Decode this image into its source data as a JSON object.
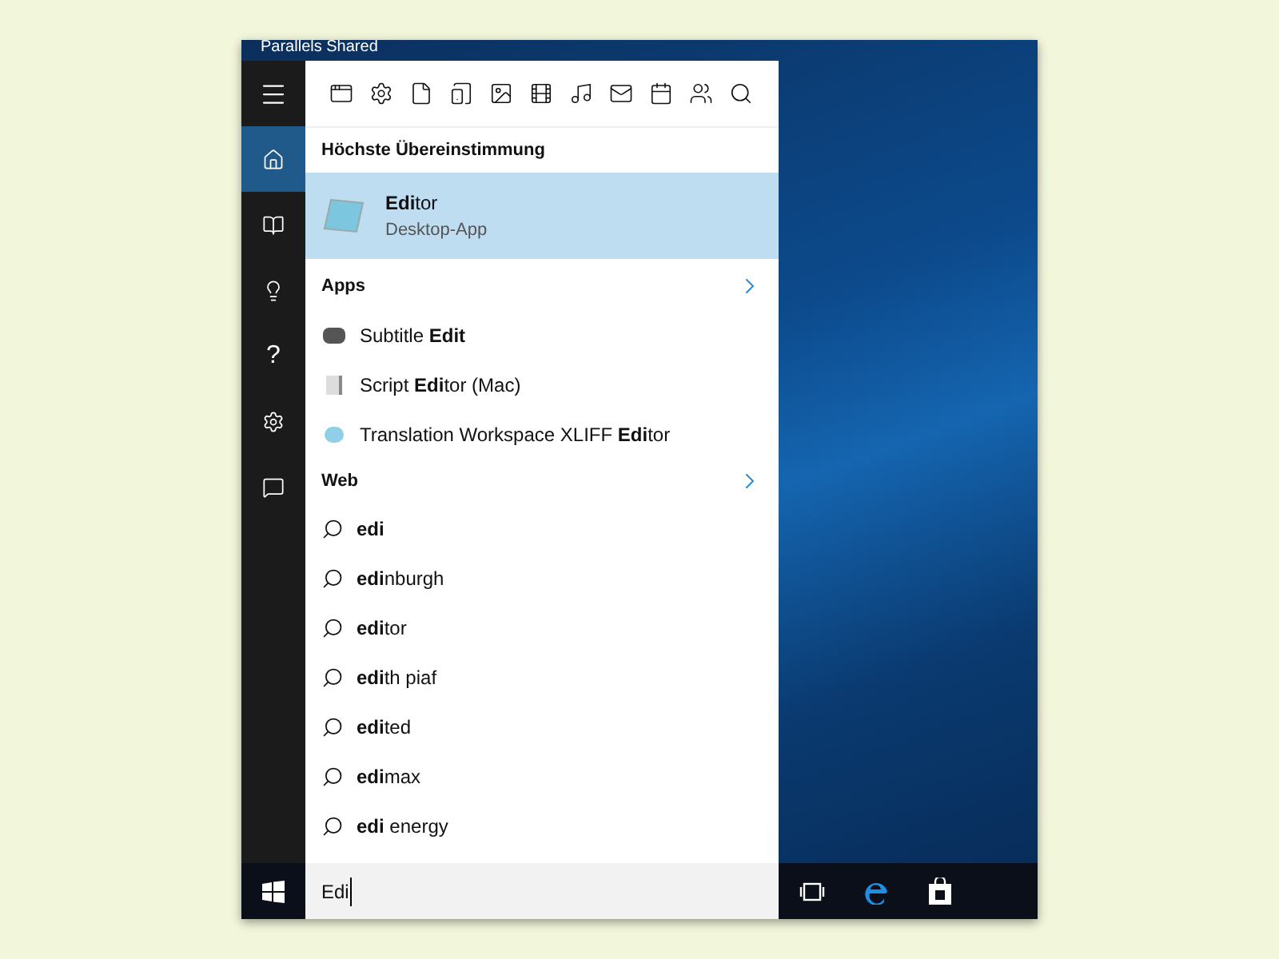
{
  "desktop": {
    "label": "Parallels Shared"
  },
  "sidebar": {
    "items": [
      {
        "kind": "menu",
        "selected": false
      },
      {
        "kind": "home",
        "selected": true
      },
      {
        "kind": "notebook",
        "selected": false
      },
      {
        "kind": "bulb",
        "selected": false
      },
      {
        "kind": "help",
        "label": "?",
        "selected": false
      },
      {
        "kind": "settings",
        "selected": false
      },
      {
        "kind": "feedback",
        "selected": false
      }
    ]
  },
  "best_match": {
    "heading": "Höchste Übereinstimmung",
    "title": "**Edi**tor",
    "subtitle": "Desktop-App",
    "selected": true
  },
  "apps": {
    "heading": "Apps",
    "items": [
      {
        "kind": "subtitle",
        "label": "Subtitle **Edit**"
      },
      {
        "kind": "script",
        "label": "Script **Edi**tor (Mac)"
      },
      {
        "kind": "xliff",
        "label": "Translation Workspace XLIFF **Edi**tor"
      }
    ]
  },
  "web": {
    "heading": "Web",
    "items": [
      {
        "label": "**edi**"
      },
      {
        "label": "**edi**nburgh"
      },
      {
        "label": "**edi**tor"
      },
      {
        "label": "**edi**th piaf"
      },
      {
        "label": "**edi**ted"
      },
      {
        "label": "**edi**max"
      },
      {
        "label": "**edi** energy"
      }
    ]
  },
  "taskbar": {
    "search": {
      "value": "Edi"
    }
  }
}
